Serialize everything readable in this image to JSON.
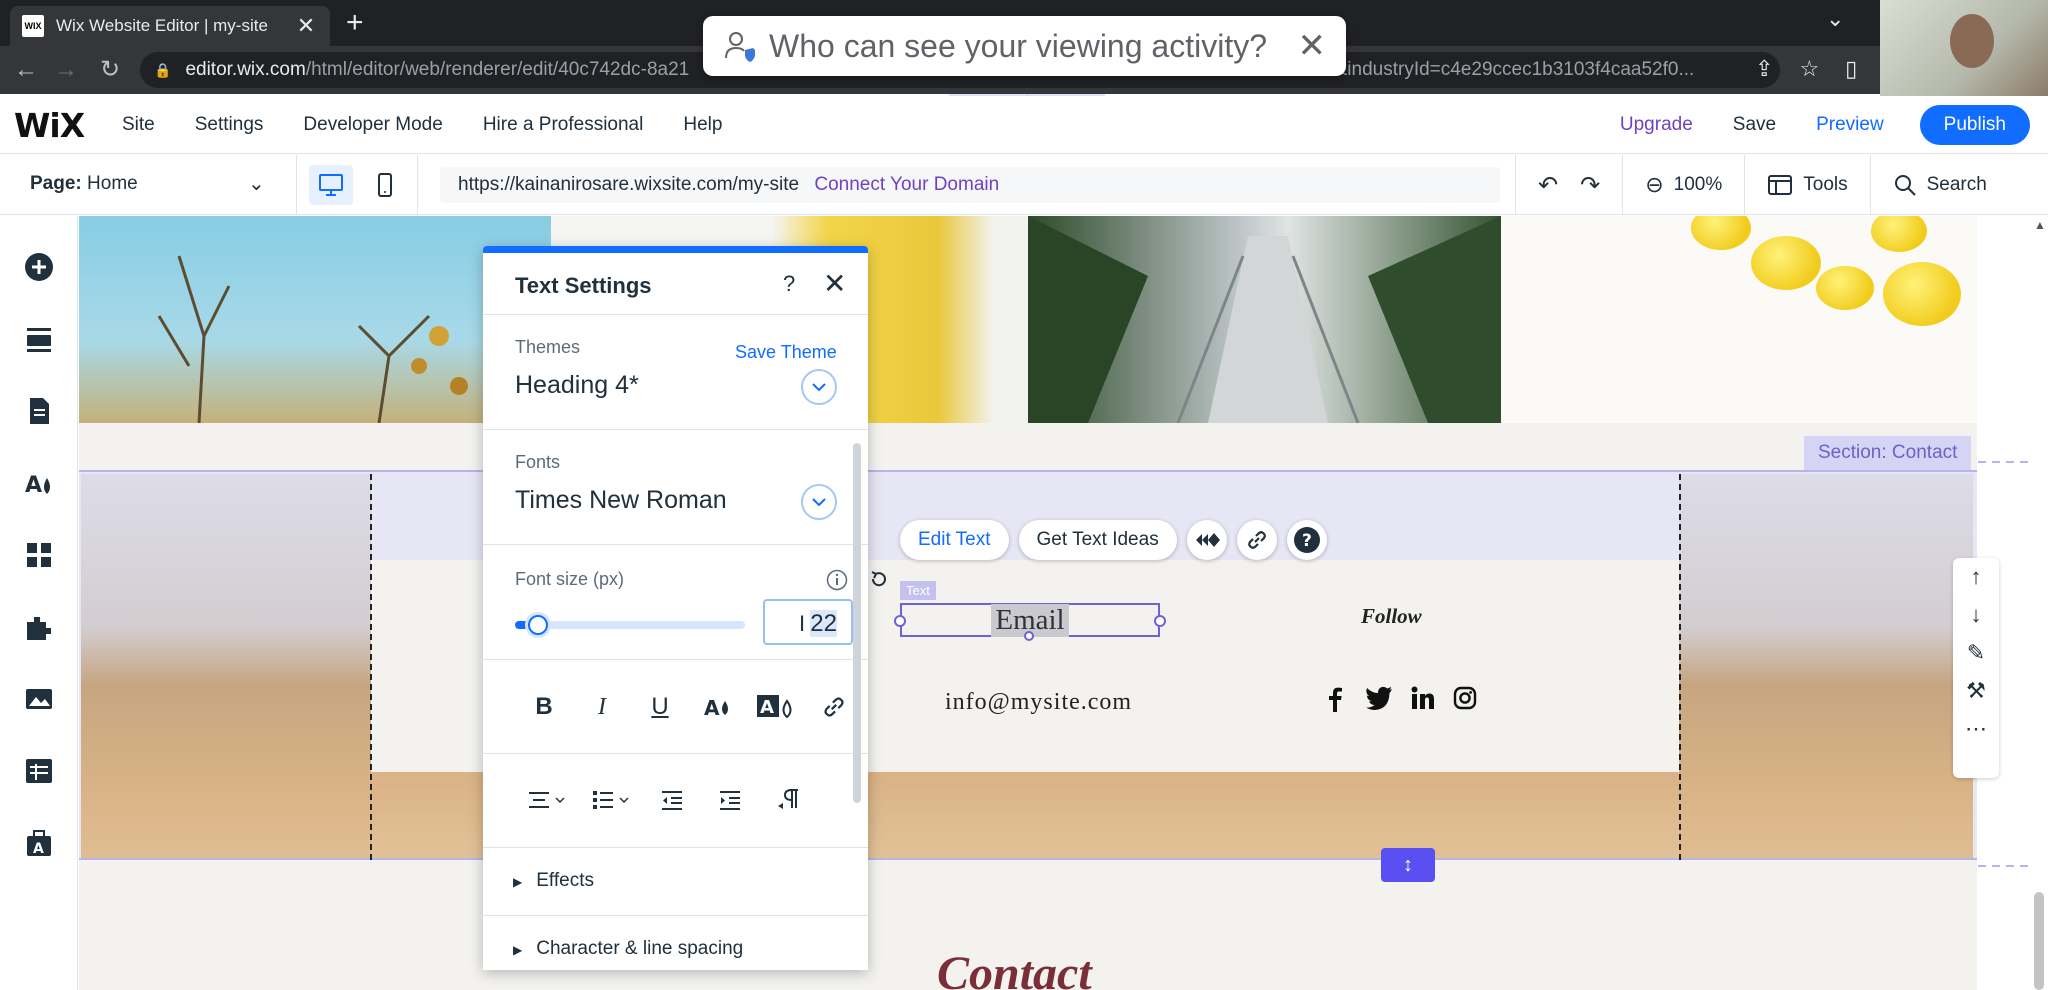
{
  "browser": {
    "tab_title": "Wix Website Editor | my-site",
    "favicon_text": "WIX",
    "url_host": "editor.wix.com",
    "url_path": "/html/editor/web/renderer/edit/40c742dc-8a21",
    "url_tail": "email&industryId=c4e29ccec1b3103f4caa52f0...",
    "privacy_toast": "Who can see your viewing activity?"
  },
  "wix_bar": {
    "logo": "WiX",
    "menu": [
      "Site",
      "Settings",
      "Developer Mode",
      "Hire a Professional",
      "Help"
    ],
    "upgrade": "Upgrade",
    "save": "Save",
    "preview": "Preview",
    "publish": "Publish"
  },
  "sub_bar": {
    "page_label": "Page:",
    "page_name": "Home",
    "site_url": "https://kainanirosare.wixsite.com/my-site",
    "connect_domain": "Connect Your Domain",
    "zoom": "100%",
    "tools": "Tools",
    "search": "Search"
  },
  "canvas": {
    "section_badge": "Section: Contact",
    "element_label": "Text",
    "selected_text": "Email",
    "follow": "Follow",
    "email_address": "info@mysite.com",
    "contact_heading": "Contact",
    "edit_toolbar": {
      "edit_text": "Edit Text",
      "get_text_ideas": "Get Text Ideas"
    },
    "socials": [
      "facebook-icon",
      "twitter-icon",
      "linkedin-icon",
      "instagram-icon"
    ]
  },
  "text_settings": {
    "title": "Text Settings",
    "help": "?",
    "themes_label": "Themes",
    "save_theme": "Save Theme",
    "theme_value": "Heading 4*",
    "fonts_label": "Fonts",
    "font_value": "Times New Roman",
    "font_size_label": "Font size (px)",
    "font_size_value": "22",
    "font_size_slider_fraction": 0.1,
    "effects": "Effects",
    "char_spacing": "Character & line spacing"
  },
  "colors": {
    "accent": "#116dff",
    "upgrade": "#6f42c1",
    "section_outline": "#b7b4ea",
    "contact_heading": "#7a2f38"
  }
}
